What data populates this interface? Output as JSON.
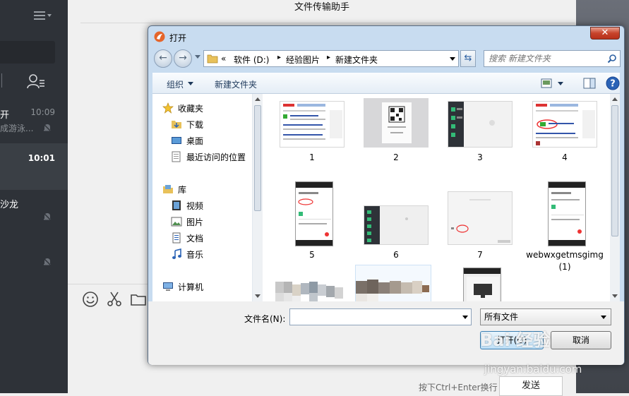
{
  "chat": {
    "title": "文件传输助手",
    "conversations": [
      {
        "name": "开",
        "preview": "成游泳...",
        "time": "10:09",
        "active": false,
        "muted": true
      },
      {
        "name": "",
        "preview": "",
        "time": "10:01",
        "active": true,
        "muted": false
      },
      {
        "name": "沙龙",
        "preview": "",
        "time": "",
        "active": false,
        "muted": true
      },
      {
        "name": "",
        "preview": "",
        "time": "",
        "active": false,
        "muted": true
      }
    ],
    "send_hint": "按下Ctrl+Enter换行",
    "send_label": "发送"
  },
  "dialog": {
    "title": "打开",
    "close_label": "✕",
    "breadcrumbs": [
      "«",
      "软件 (D:)",
      "经验图片",
      "新建文件夹"
    ],
    "search_placeholder": "搜索 新建文件夹",
    "commands": {
      "organize": "组织",
      "new_folder": "新建文件夹"
    },
    "nav": {
      "favorites": {
        "label": "收藏夹",
        "items": [
          "下载",
          "桌面",
          "最近访问的位置"
        ]
      },
      "libraries": {
        "label": "库",
        "items": [
          "视频",
          "图片",
          "文档",
          "音乐"
        ]
      },
      "computer": {
        "label": "计算机"
      }
    },
    "files": [
      {
        "label": "1"
      },
      {
        "label": "2"
      },
      {
        "label": "3"
      },
      {
        "label": "4"
      },
      {
        "label": "5"
      },
      {
        "label": "6"
      },
      {
        "label": "7"
      },
      {
        "label": "webwxgetmsgimg (1)"
      },
      {
        "label": ""
      },
      {
        "label": ""
      },
      {
        "label": ""
      }
    ],
    "footer": {
      "filename_label": "文件名(N):",
      "filename_value": "",
      "filetype": "所有文件",
      "open_label": "打开(O)",
      "cancel_label": "取消"
    }
  },
  "watermark": {
    "logo": "Bai 经验",
    "url": "jingyan.baidu.com"
  },
  "colors": {
    "sidebar": "#2e3238",
    "dialog_frame": "#c8dcf0",
    "close_red": "#c7432b",
    "nav_text": "#1e395b"
  }
}
